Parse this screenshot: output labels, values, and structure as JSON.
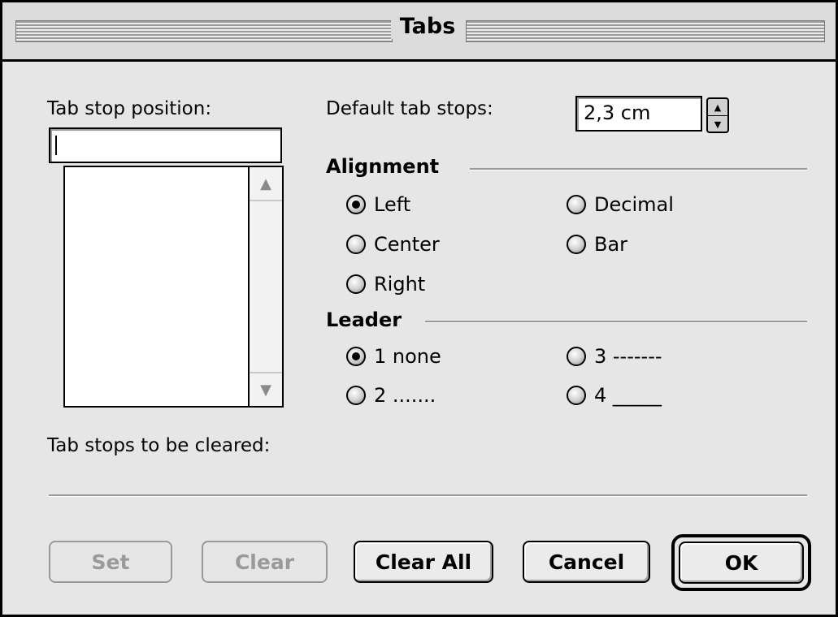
{
  "window": {
    "title": "Tabs"
  },
  "tab_stop_position": {
    "label": "Tab stop position:",
    "value": ""
  },
  "default_tab_stops": {
    "label": "Default tab stops:",
    "value": "2,3 cm"
  },
  "alignment": {
    "heading": "Alignment",
    "options": [
      {
        "label": "Left",
        "selected": true
      },
      {
        "label": "Center",
        "selected": false
      },
      {
        "label": "Right",
        "selected": false
      },
      {
        "label": "Decimal",
        "selected": false
      },
      {
        "label": "Bar",
        "selected": false
      }
    ]
  },
  "leader": {
    "heading": "Leader",
    "options": [
      {
        "label": "1 none",
        "selected": true
      },
      {
        "label": "2 .......",
        "selected": false
      },
      {
        "label": "3 -------",
        "selected": false
      },
      {
        "label": "4 _____",
        "selected": false
      }
    ]
  },
  "tab_stops_cleared": {
    "label": "Tab stops to be cleared:"
  },
  "buttons": {
    "set": "Set",
    "clear": "Clear",
    "clear_all": "Clear All",
    "cancel": "Cancel",
    "ok": "OK"
  }
}
